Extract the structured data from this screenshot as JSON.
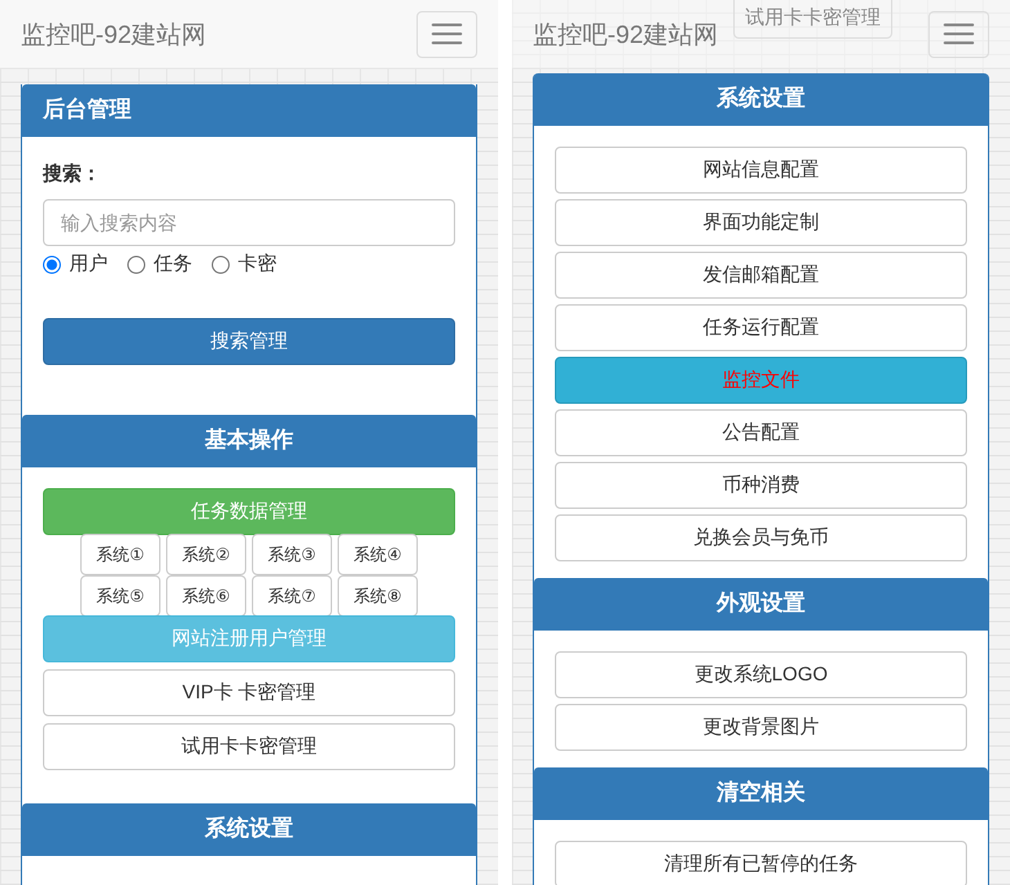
{
  "screens": [
    {
      "navbar": {
        "brand": "监控吧-92建站网"
      },
      "panels": [
        {
          "title": "后台管理",
          "left_aligned": true,
          "items": [
            {
              "kind": "search",
              "label": "搜索：",
              "placeholder": "输入搜索内容",
              "options": [
                {
                  "label": "用户",
                  "selected": true
                },
                {
                  "label": "任务",
                  "selected": false
                },
                {
                  "label": "卡密",
                  "selected": false
                }
              ],
              "button": "搜索管理"
            }
          ]
        },
        {
          "title": "基本操作",
          "left_aligned": false,
          "items": [
            {
              "kind": "success",
              "label": "任务数据管理"
            },
            {
              "kind": "grid",
              "labels": [
                "系统①",
                "系统②",
                "系统③",
                "系统④",
                "系统⑤",
                "系统⑥",
                "系统⑦",
                "系统⑧"
              ]
            },
            {
              "kind": "info",
              "label": "网站注册用户管理"
            },
            {
              "kind": "default",
              "label": "VIP卡 卡密管理"
            },
            {
              "kind": "default",
              "label": "试用卡卡密管理"
            }
          ]
        },
        {
          "title": "系统设置",
          "left_aligned": false
        }
      ]
    },
    {
      "navbar": {
        "brand": "监控吧-92建站网"
      },
      "behind": "试用卡卡密管理",
      "panels": [
        {
          "title": "系统设置",
          "left_aligned": false,
          "items": [
            {
              "kind": "default",
              "label": "网站信息配置"
            },
            {
              "kind": "default",
              "label": "界面功能定制"
            },
            {
              "kind": "default",
              "label": "发信邮箱配置"
            },
            {
              "kind": "default",
              "label": "任务运行配置"
            },
            {
              "kind": "highlight",
              "label": "监控文件"
            },
            {
              "kind": "default",
              "label": "公告配置"
            },
            {
              "kind": "default",
              "label": "币种消费"
            },
            {
              "kind": "default",
              "label": "兑换会员与免币"
            }
          ]
        },
        {
          "title": "外观设置",
          "left_aligned": false,
          "items": [
            {
              "kind": "default",
              "label": "更改系统LOGO"
            },
            {
              "kind": "default",
              "label": "更改背景图片"
            }
          ]
        },
        {
          "title": "清空相关",
          "left_aligned": false,
          "items": [
            {
              "kind": "default",
              "label": "清理所有已暂停的任务"
            }
          ]
        }
      ]
    }
  ]
}
